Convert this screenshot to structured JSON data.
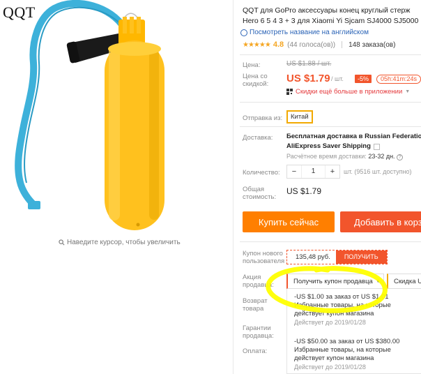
{
  "watermark": "QQT",
  "zoom_hint": "Наведите курсор, чтобы увеличить",
  "product": {
    "title_line1": "QQT для GoPro аксессуары конец круглый стерж",
    "title_line2": "Hero 6 5 4 3 + 3 для Xiaomi Yi Sjcam SJ4000 SJ5000 ,",
    "translate_link": "Посмотреть название на английском",
    "rating_value": "4.8",
    "votes": "(44 голоса(ов))",
    "orders": "148 заказа(ов)"
  },
  "labels": {
    "price": "Цена:",
    "discount_price_1": "Цена со",
    "discount_price_2": "скидкой:",
    "ship_from": "Отправка из:",
    "delivery": "Доставка:",
    "quantity": "Количество:",
    "total_1": "Общая",
    "total_2": "стоимость:",
    "new_user_coupon_1": "Купон нового",
    "new_user_coupon_2": "пользователя",
    "seller_promo_1": "Акция",
    "seller_promo_2": "продавца:",
    "return_1": "Возврат",
    "return_2": "товара",
    "guarantee_1": "Гарантии",
    "guarantee_2": "продавца:",
    "payment": "Оплата:"
  },
  "pricing": {
    "old_price": "US $1.88 / шт.",
    "price": "US $1.79",
    "per_unit": "/ шт.",
    "discount": "-5%",
    "timer": "05h:41m:24s",
    "app_discount": "Скидки ещё больше в приложении"
  },
  "shipping": {
    "from": "Китай",
    "delivery_main": "Бесплатная доставка в Russian Federation c",
    "delivery_service": "AliExpress Saver Shipping",
    "delivery_time_label": "Расчётное время доставки:",
    "delivery_time": "23-32 дн."
  },
  "quantity": {
    "minus": "−",
    "value": "1",
    "plus": "+",
    "note": "шт. (9516 шт. доступно)"
  },
  "total": "US $1.79",
  "buttons": {
    "buy_now": "Купить сейчас",
    "add_to_cart": "Добавить в корз"
  },
  "coupon": {
    "value": "135,48 руб.",
    "get": "ПОЛУЧИТЬ"
  },
  "promo": {
    "select": "Получить купон продавца",
    "select2": "Скидка US"
  },
  "coupons": [
    {
      "line1": "-US $1.00 за заказ от US $1.01",
      "line2": "Избранные товары, на которые",
      "line3": "действует купон магазина",
      "until": "Действует до 2019/01/28"
    },
    {
      "line1": "-US $50.00 за заказ от US $380.00",
      "line2": "Избранные товары, на которые",
      "line3": "действует купон магазина",
      "until": "Действует до 2019/01/28"
    }
  ],
  "colors": {
    "accent": "#f2552c",
    "buy_now": "#ff7f00",
    "highlight": "#ffff00",
    "product_yellow": "#ffc11e",
    "strap_blue": "#3db1da"
  }
}
